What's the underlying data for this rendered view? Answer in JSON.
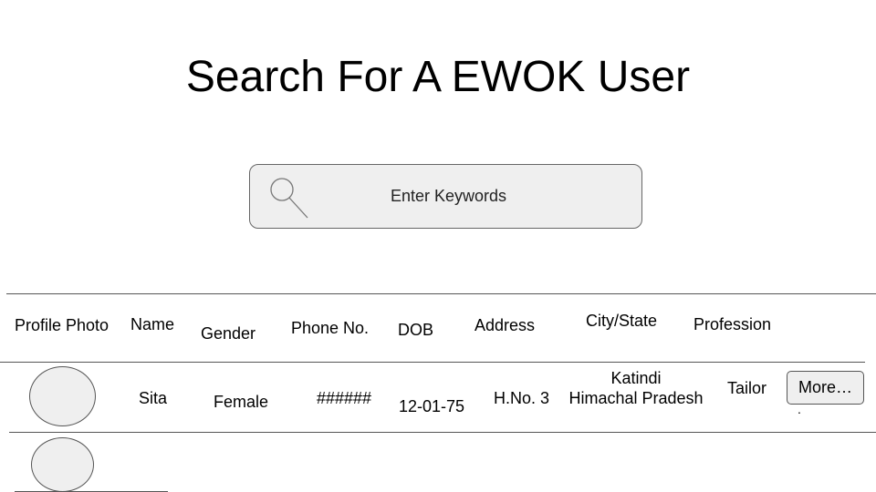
{
  "page": {
    "title": "Search For A EWOK User"
  },
  "search": {
    "placeholder": "Enter Keywords",
    "icon": "magnifier"
  },
  "table": {
    "headers": [
      "Profile Photo",
      "Name",
      "Gender",
      "Phone No.",
      "DOB",
      "Address",
      "City/State",
      "Profession"
    ],
    "rows": [
      {
        "name": "Sita",
        "gender": "Female",
        "phone": "######",
        "dob": "12-01-75",
        "address": "H.No. 3",
        "city": "Katindi",
        "state": "Himachal Pradesh",
        "profession": "Tailor",
        "more_label": "More…",
        "more_trailing": "."
      }
    ]
  }
}
